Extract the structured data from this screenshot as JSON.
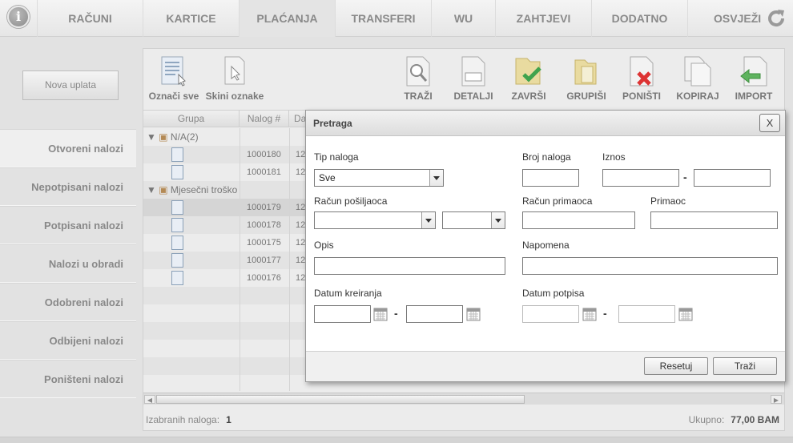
{
  "nav": {
    "tabs": [
      {
        "label": "RAČUNI"
      },
      {
        "label": "KARTICE"
      },
      {
        "label": "PLAĆANJA"
      },
      {
        "label": "TRANSFERI"
      },
      {
        "label": "WU"
      },
      {
        "label": "ZAHTJEVI"
      },
      {
        "label": "DODATNO"
      }
    ],
    "active_tab": "PLAĆANJA",
    "refresh_label": "OSVJEŽI",
    "info_glyph": "i"
  },
  "sidebar": {
    "new_payment_label": "Nova uplata",
    "items": [
      {
        "label": "Otvoreni nalozi"
      },
      {
        "label": "Nepotpisani nalozi"
      },
      {
        "label": "Potpisani nalozi"
      },
      {
        "label": "Nalozi u obradi"
      },
      {
        "label": "Odobreni nalozi"
      },
      {
        "label": "Odbijeni nalozi"
      },
      {
        "label": "Poništeni nalozi"
      }
    ]
  },
  "toolbar": {
    "select_all": "Označi sve",
    "deselect": "Skini oznake",
    "search": "TRAŽI",
    "details": "DETALJI",
    "finish": "ZAVRŠI",
    "group": "GRUPIŠI",
    "cancel": "PONIŠTI",
    "copy": "KOPIRAJ",
    "import": "IMPORT"
  },
  "grid": {
    "columns": [
      "Grupa",
      "Nalog #",
      "Da"
    ],
    "groups": [
      {
        "label": "N/A(2)",
        "rows": [
          {
            "nalog": "1000180",
            "date_prefix": "12"
          },
          {
            "nalog": "1000181",
            "date_prefix": "12"
          }
        ]
      },
      {
        "label": "Mjesečni troško",
        "rows": [
          {
            "nalog": "1000179",
            "date_prefix": "12"
          },
          {
            "nalog": "1000178",
            "date_prefix": "12"
          },
          {
            "nalog": "1000175",
            "date_prefix": "12"
          },
          {
            "nalog": "1000177",
            "date_prefix": "12"
          },
          {
            "nalog": "1000176",
            "date_prefix": "12"
          }
        ]
      }
    ],
    "selected_nalog": "1000179"
  },
  "status": {
    "selected_label": "Izabranih naloga:",
    "selected_count": "1",
    "total_label": "Ukupno:",
    "total_value": "77,00 BAM"
  },
  "dialog": {
    "title": "Pretraga",
    "close_label": "X",
    "fields": {
      "tip_naloga_label": "Tip naloga",
      "tip_naloga_value": "Sve",
      "broj_naloga_label": "Broj naloga",
      "iznos_label": "Iznos",
      "racun_posiljaoca_label": "Račun pošiljaoca",
      "racun_primaoca_label": "Račun primaoca",
      "primaoc_label": "Primaoc",
      "opis_label": "Opis",
      "napomena_label": "Napomena",
      "datum_kreiranja_label": "Datum kreiranja",
      "datum_potpisa_label": "Datum potpisa"
    },
    "range_separator": "-",
    "reset_label": "Resetuj",
    "search_label": "Traži"
  }
}
